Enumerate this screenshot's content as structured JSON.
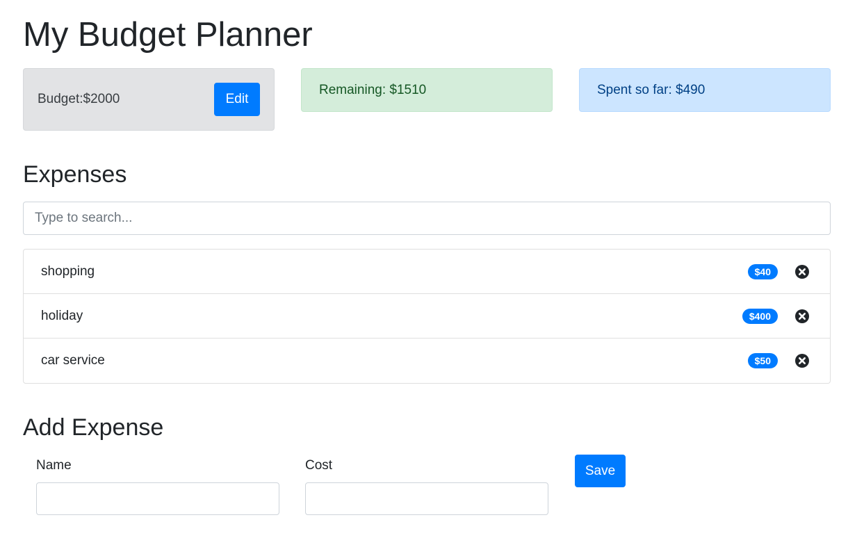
{
  "page": {
    "title": "My Budget Planner"
  },
  "budget": {
    "label": "Budget:$2000",
    "edit_label": "Edit",
    "remaining_label": "Remaining: $1510",
    "spent_label": "Spent so far: $490"
  },
  "expenses": {
    "heading": "Expenses",
    "search_placeholder": "Type to search...",
    "items": [
      {
        "name": "shopping",
        "cost": "$40"
      },
      {
        "name": "holiday",
        "cost": "$400"
      },
      {
        "name": "car service",
        "cost": "$50"
      }
    ]
  },
  "add_expense": {
    "heading": "Add Expense",
    "name_label": "Name",
    "cost_label": "Cost",
    "save_label": "Save"
  },
  "icons": {
    "delete": "times-circle-icon"
  },
  "colors": {
    "primary": "#007bff",
    "budget_bg": "#e2e3e5",
    "remaining_bg": "#d4edda",
    "spent_bg": "#cce5ff"
  }
}
